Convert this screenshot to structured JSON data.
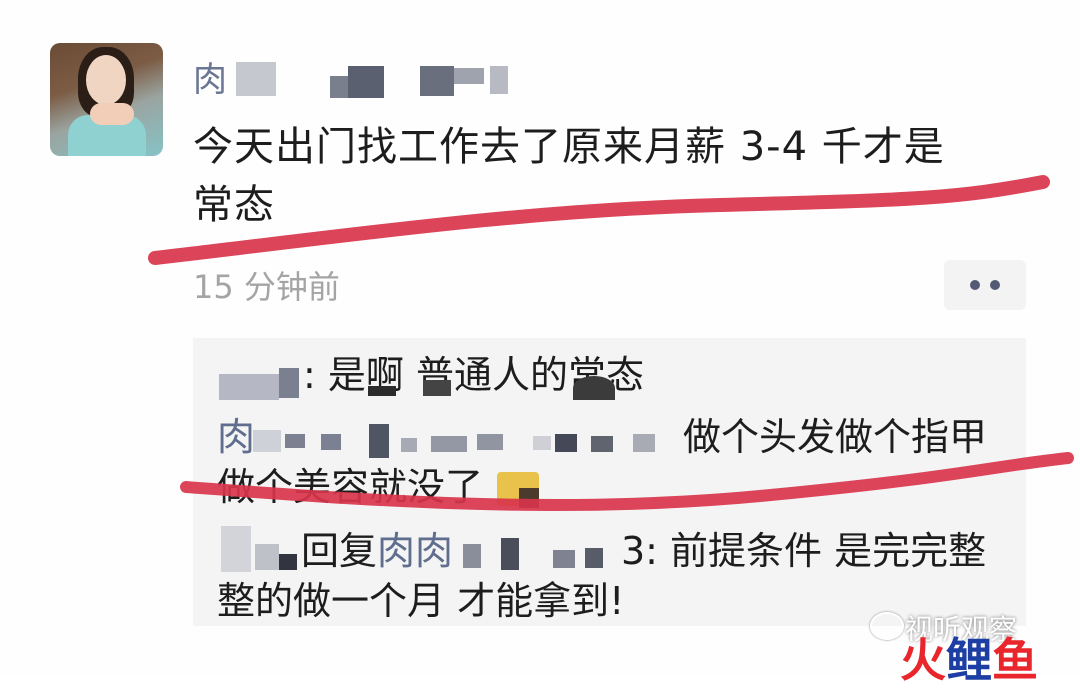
{
  "post": {
    "author_visible": "肉",
    "text_line1": "今天出门找工作去了原来月薪 3-4 千才是",
    "text_line2": "常态",
    "time": "15 分钟前"
  },
  "comments": [
    {
      "author_prefix": "",
      "text": ": 是啊  普通人的常态"
    },
    {
      "author_prefix": "肉",
      "text_line1": "做个头发做个指甲",
      "text_line2": "做个美容就没了"
    },
    {
      "reply_label": "回复",
      "reply_target": "肉肉",
      "text_line1": "3: 前提条件 是完完整",
      "text_line2": "整的做一个月 才能拿到!"
    }
  ],
  "watermark": {
    "text": "视听观察",
    "logo_1": "火",
    "logo_2": "鲤",
    "logo_3": "鱼"
  },
  "colors": {
    "marker_red": "#d8344b",
    "name_blue": "#5f6d8f",
    "comment_bg": "#f4f4f4"
  }
}
